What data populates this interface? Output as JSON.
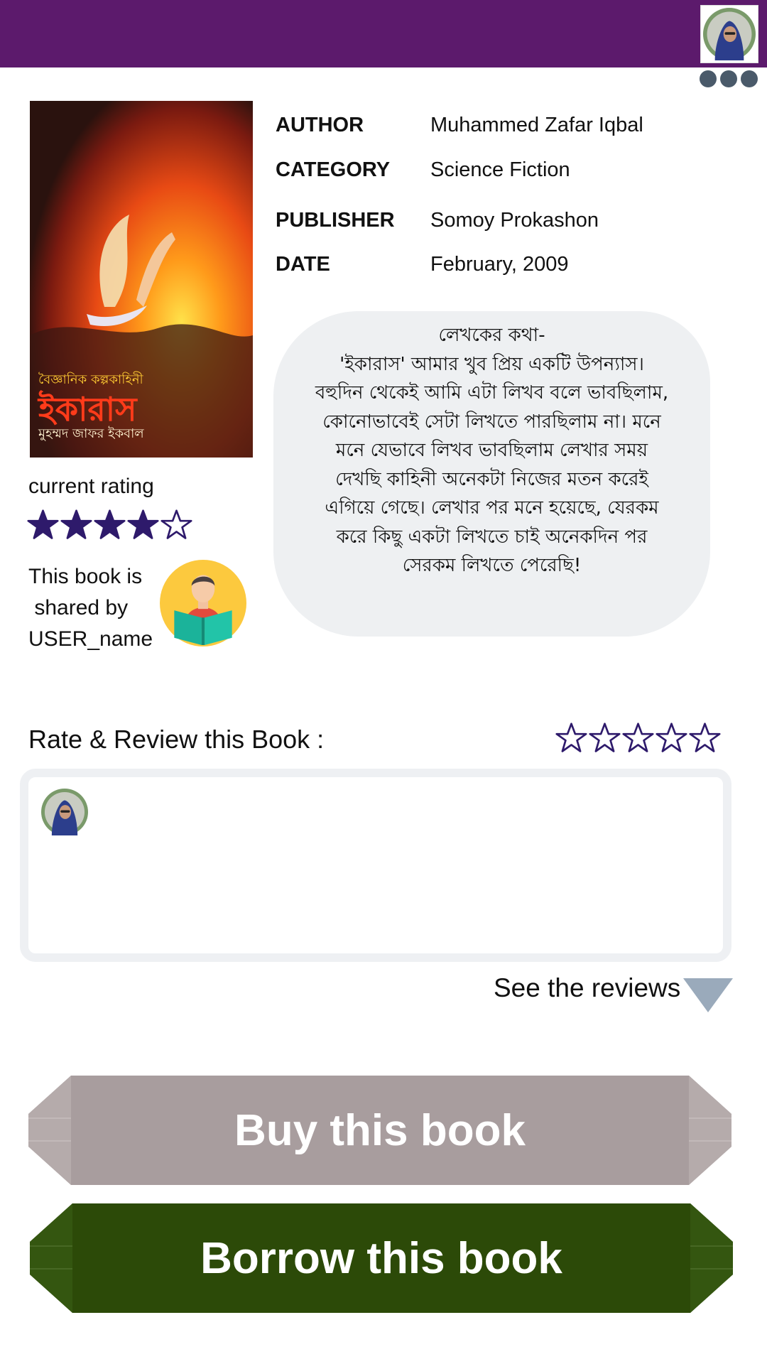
{
  "header": {
    "bg_color": "#5c1a6c",
    "avatar": "user-avatar",
    "menu_icon": "more-dots-icon"
  },
  "book": {
    "cover": {
      "genre": "বৈজ্ঞানিক কল্পকাহিনী",
      "title": "ইকারাস",
      "author": "মুহম্মদ জাফর ইকবাল"
    },
    "details": [
      {
        "label": "AUTHOR",
        "value": "Muhammed Zafar Iqbal"
      },
      {
        "label": "CATEGORY",
        "value": "Science Fiction"
      },
      {
        "label": "PUBLISHER",
        "value": "Somoy Prokashon"
      },
      {
        "label": "DATE",
        "value": "February, 2009"
      }
    ],
    "description": [
      "লেখকের কথা-",
      "'ইকারাস' আমার খুব প্রিয় একটি উপন্যাস।",
      "বহুদিন থেকেই আমি এটা লিখব বলে ভাবছিলাম,",
      "কোনোভাবেই সেটা লিখতে পারছিলাম না। মনে",
      "মনে যেভাবে লিখব ভাবছিলাম লেখার সময়",
      "দেখছি কাহিনী অনেকটা নিজের মতন করেই",
      "এগিয়ে গেছে। লেখার পর মনে হয়েছে, যেরকম",
      "করে কিছু একটা লিখতে চাই অনেকদিন পর",
      "সেরকম লিখতে পেরেছি!"
    ]
  },
  "rating": {
    "label": "current rating",
    "value": 4,
    "max": 5,
    "star_color": "#2e1a6b"
  },
  "shared": {
    "text": "This book is\n shared by\nUSER_name",
    "icon": "reader-icon"
  },
  "review": {
    "label": "Rate & Review this Book :",
    "stars_max": 5,
    "input_placeholder": "",
    "see_reviews": "See the reviews",
    "arrow_color": "#9aaabb"
  },
  "actions": {
    "buy_label": "Buy this book",
    "buy_color": "#a89d9e",
    "borrow_label": "Borrow this book",
    "borrow_color": "#2c4a08"
  }
}
